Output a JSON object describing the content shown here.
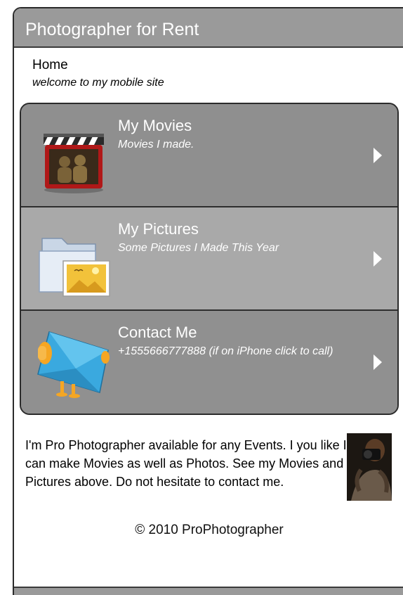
{
  "header": {
    "title": "Photographer for Rent"
  },
  "breadcrumb": {
    "label": "Home",
    "subtitle": "welcome to my mobile site"
  },
  "menu": {
    "items": [
      {
        "label": "My Movies",
        "sub": "Movies I made.",
        "icon": "movie-clapper-icon"
      },
      {
        "label": "My Pictures",
        "sub": "Some Pictures I Made This Year",
        "icon": "picture-folder-icon"
      },
      {
        "label": "Contact Me",
        "sub": "+1555666777888 (if on iPhone click to call)",
        "icon": "envelope-icon"
      }
    ]
  },
  "about": {
    "text": "I'm Pro Photographer available for any Events. I you like I can make Movies as well as Photos. See my Movies and Pictures above. Do not hesitate to contact me."
  },
  "footer": {
    "copyright": "© 2010 ProPhotographer"
  },
  "colors": {
    "header_bg": "#9a9a9a",
    "menu_item_dark": "#8f8f8f",
    "menu_item_light": "#a9a9a9",
    "text_on_menu": "#ffffff"
  }
}
